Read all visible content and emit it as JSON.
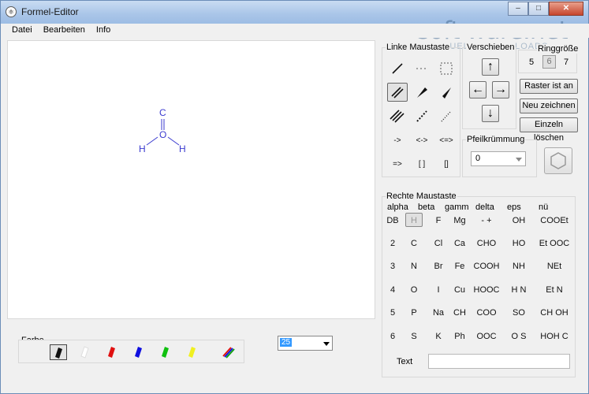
{
  "window": {
    "title": "Formel-Editor",
    "controls": [
      "–",
      "□",
      "✕"
    ]
  },
  "watermark": {
    "main": "soft·ware.net",
    "sub": "AKTUELLE DOWNLOADS"
  },
  "menu": [
    "Datei",
    "Bearbeiten",
    "Info"
  ],
  "molecule": {
    "atoms": {
      "top": "C",
      "center": "O",
      "left": "H",
      "right": "H"
    },
    "color": "#3a3acf"
  },
  "colors": {
    "label": "Farbe",
    "pens": [
      {
        "name": "black",
        "hex": "#111111"
      },
      {
        "name": "white",
        "hex": "#ffffff"
      },
      {
        "name": "red",
        "hex": "#e01010"
      },
      {
        "name": "blue",
        "hex": "#1010e0"
      },
      {
        "name": "green",
        "hex": "#10c010"
      },
      {
        "name": "yellow",
        "hex": "#f0f020"
      }
    ],
    "selected": "black"
  },
  "zoom": {
    "value": "25"
  },
  "left_mouse": {
    "label": "Linke Maustaste",
    "row4": [
      "->",
      "<->",
      "<=>"
    ],
    "row5": [
      "=>",
      "[ ]",
      "[]"
    ]
  },
  "move": {
    "label": "Verschieben"
  },
  "ring": {
    "label": "Ringgröße",
    "options": [
      "5",
      "6",
      "7"
    ],
    "selected": "6"
  },
  "buttons": {
    "grid": "Raster ist an",
    "redraw": "Neu zeichnen",
    "delete_single": "Einzeln löschen"
  },
  "arrow_curve": {
    "label": "Pfeilkrümmung",
    "value": "0"
  },
  "right_mouse": {
    "label": "Rechte Maustaste",
    "headers": [
      "alpha",
      "beta",
      "gamm",
      "delta",
      "eps",
      "nü"
    ],
    "rows": [
      [
        "DB",
        "H",
        "F",
        "Mg",
        "-    +",
        "OH",
        "COOEt"
      ],
      [
        "2",
        "C",
        "Cl",
        "Ca",
        "CHO",
        "HO",
        "Et OOC"
      ],
      [
        "3",
        "N",
        "Br",
        "Fe",
        "COOH",
        "NH",
        "NEt"
      ],
      [
        "4",
        "O",
        "I",
        "Cu",
        "HOOC",
        "H N",
        "Et N"
      ],
      [
        "5",
        "P",
        "Na",
        "CH",
        "COO",
        "SO",
        "CH OH"
      ],
      [
        "6",
        "S",
        "K",
        "Ph",
        "OOC",
        "O S",
        "HOH C"
      ]
    ],
    "selected": "H",
    "text_label": "Text",
    "text_value": ""
  }
}
